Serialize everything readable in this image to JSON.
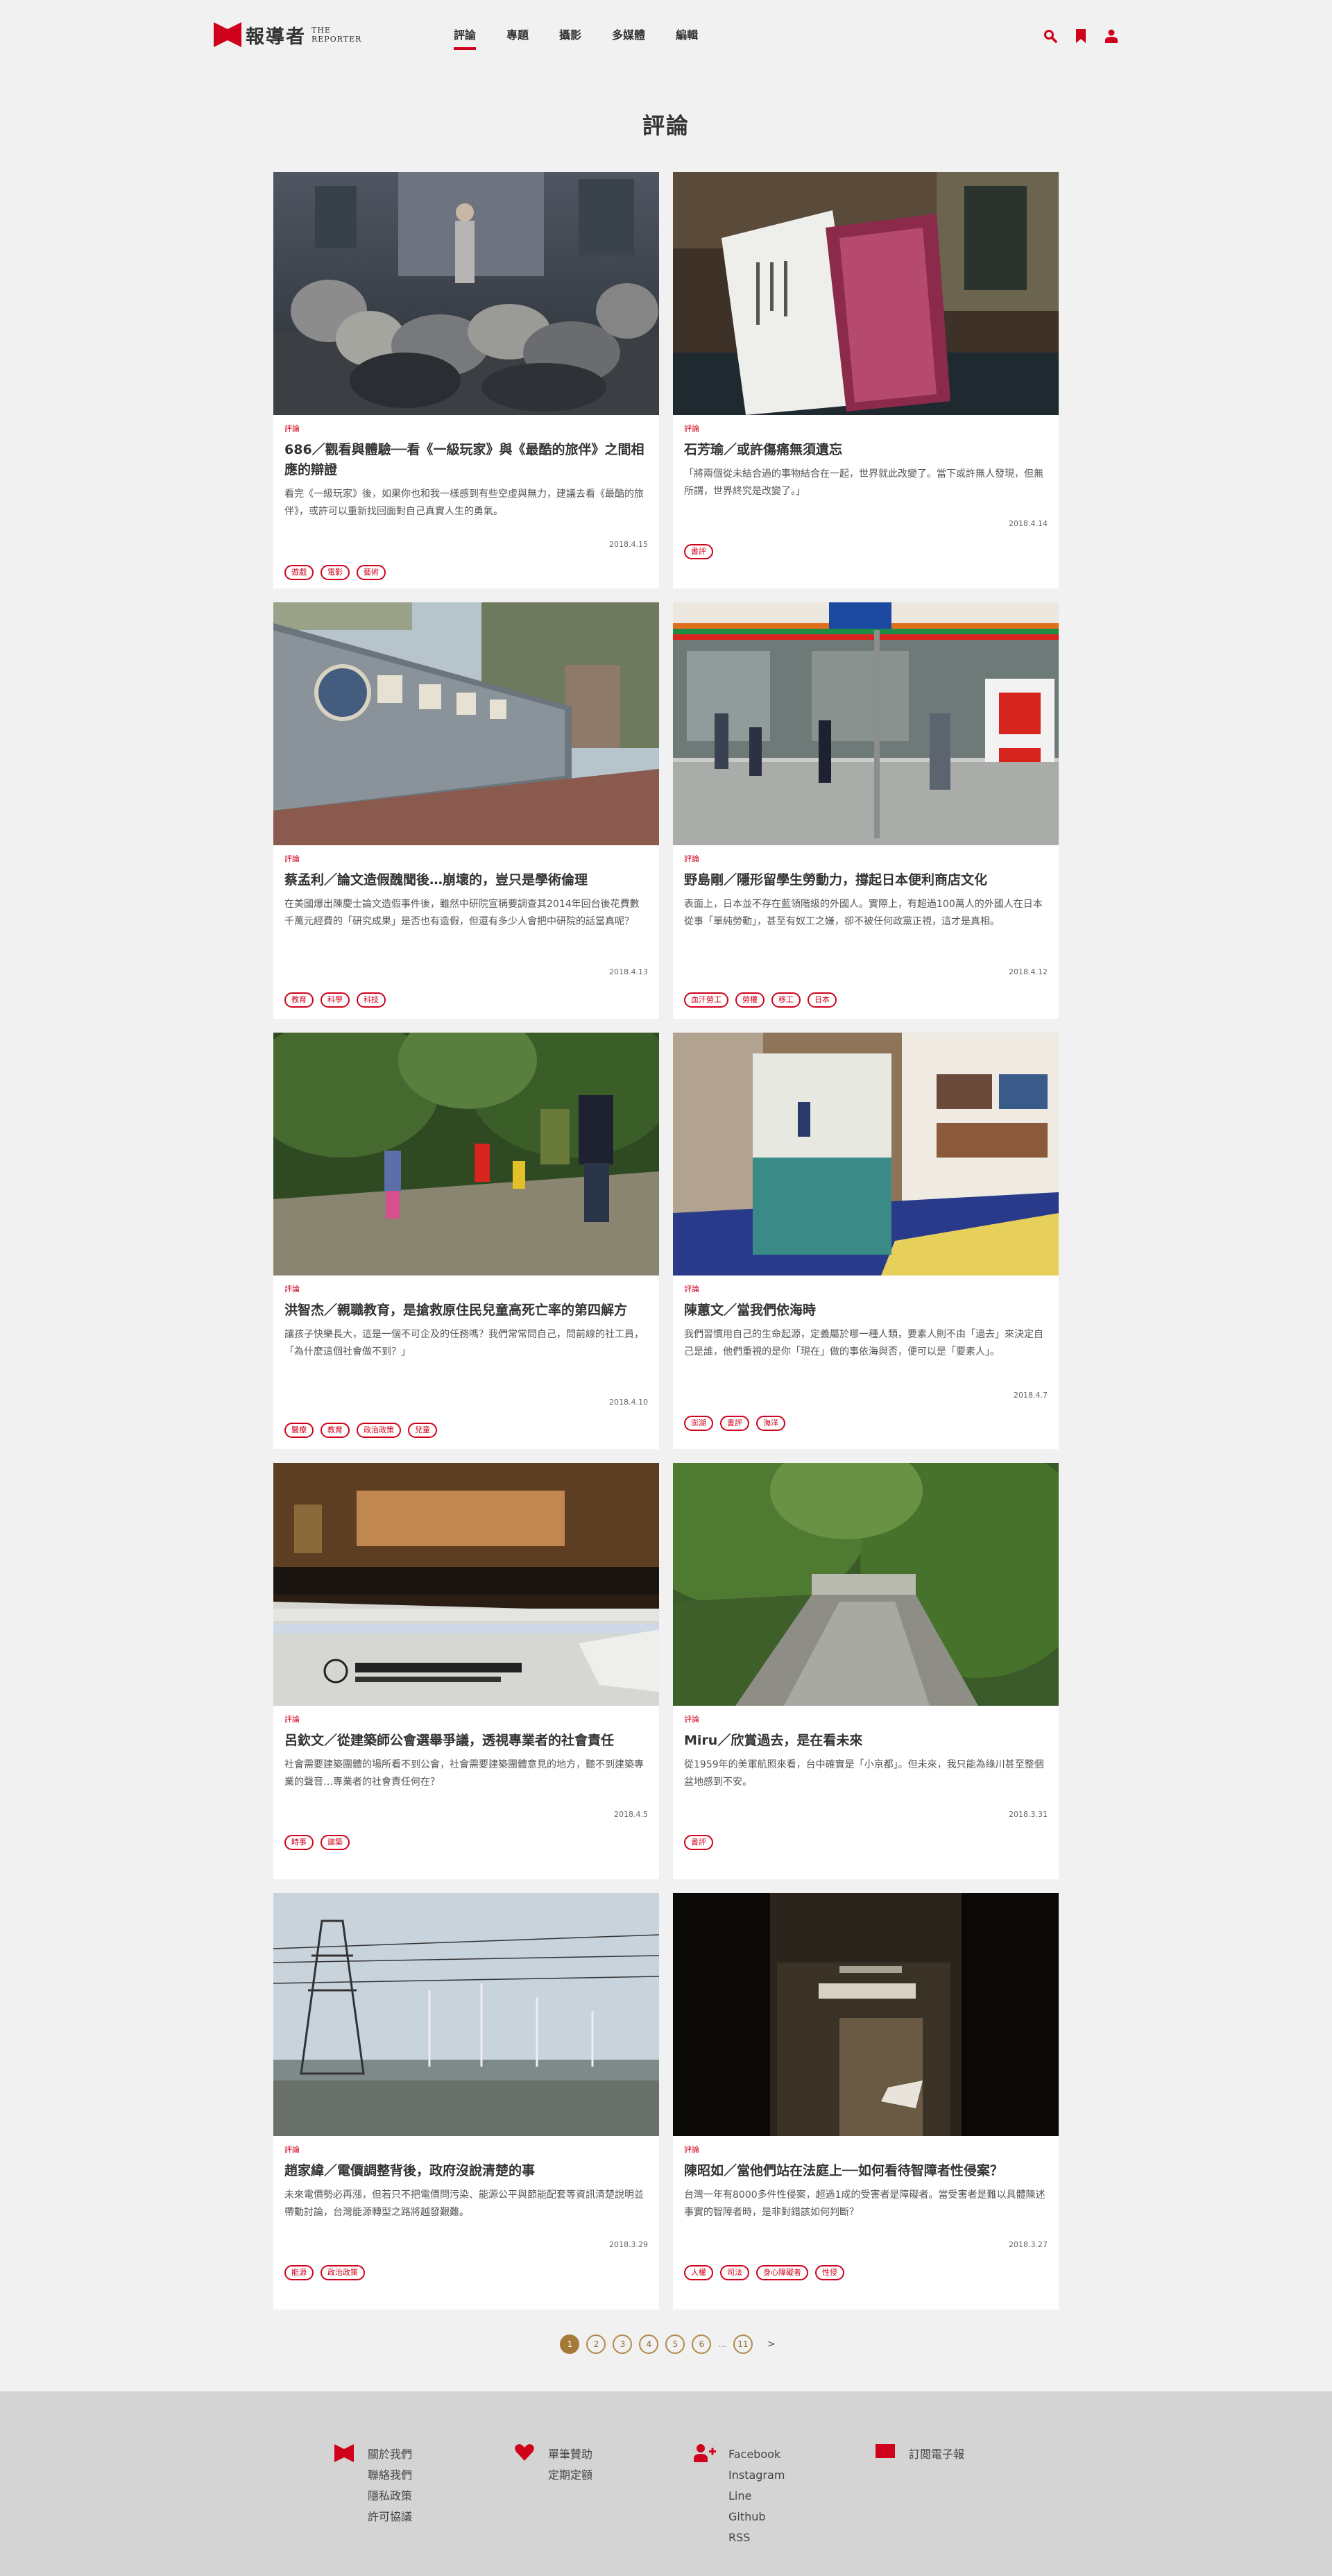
{
  "brand": {
    "name_zh": "報導者",
    "name_en_1": "THE",
    "name_en_2": "REPORTER"
  },
  "nav": [
    {
      "label": "評論",
      "active": true
    },
    {
      "label": "專題",
      "active": false
    },
    {
      "label": "攝影",
      "active": false
    },
    {
      "label": "多媒體",
      "active": false
    },
    {
      "label": "編輯",
      "active": false
    }
  ],
  "tools": [
    "search-icon",
    "bookmark-icon",
    "user-icon"
  ],
  "colors": {
    "accent": "#d0021b",
    "pagination": "#a47a36",
    "background": "#f1f1f1",
    "footer": "#d4d4d4"
  },
  "section_title": "評論",
  "articles": [
    {
      "category": "評論",
      "title": "686／觀看與體驗──看《一級玩家》與《最酷的旅伴》之間相應的辯證",
      "desc": "看完《一級玩家》後，如果你也和我一樣感到有些空虛與無力，建議去看《最酷的旅伴》，或許可以重新找回面對自己真實人生的勇氣。",
      "date": "2018.4.15",
      "tags": [
        "遊戲",
        "電影",
        "藝術"
      ]
    },
    {
      "category": "評論",
      "title": "石芳瑜／或許傷痛無須遺忘",
      "desc": "「將兩個從未結合過的事物結合在一起，世界就此改變了。當下或許無人發現，但無所謂，世界終究是改變了。」",
      "date": "2018.4.14",
      "tags": [
        "書評"
      ]
    },
    {
      "category": "評論",
      "title": "蔡孟利／論文造假醜聞後…崩壞的，豈只是學術倫理",
      "desc": "在美國爆出陳慶士論文造假事件後，雖然中研院宣稱要調查其2014年回台後花費數千萬元經費的「研究成果」是否也有造假，但還有多少人會把中研院的話當真呢？",
      "date": "2018.4.13",
      "tags": [
        "教育",
        "科學",
        "科技"
      ]
    },
    {
      "category": "評論",
      "title": "野島剛／隱形留學生勞動力，撐起日本便利商店文化",
      "desc": "表面上，日本並不存在藍領階級的外國人。實際上，有超過100萬人的外國人在日本從事「單純勞動」，甚至有奴工之嫌，卻不被任何政黨正視，這才是真相。",
      "date": "2018.4.12",
      "tags": [
        "血汗勞工",
        "勞權",
        "移工",
        "日本"
      ]
    },
    {
      "category": "評論",
      "title": "洪智杰／親職教育，是搶救原住民兒童高死亡率的第四解方",
      "desc": "讓孩子快樂長大，這是一個不可企及的任務嗎？我們常常問自己，問前線的社工員，「為什麼這個社會做不到？」",
      "date": "2018.4.10",
      "tags": [
        "醫療",
        "教育",
        "政治政策",
        "兒童"
      ]
    },
    {
      "category": "評論",
      "title": "陳蕙文／當我們依海時",
      "desc": "我們習慣用自己的生命起源，定義屬於哪一種人類，要素人則不由「過去」來決定自己是誰，他們重視的是你「現在」做的事依海與否，便可以是「要素人」。",
      "date": "2018.4.7",
      "tags": [
        "澎湖",
        "書評",
        "海洋"
      ]
    },
    {
      "category": "評論",
      "title": "呂欽文／從建築師公會選舉爭議，透視專業者的社會責任",
      "desc": "社會需要建築團體的場所看不到公會，社會需要建築團體意見的地方，聽不到建築專業的聲音…專業者的社會責任何在？",
      "date": "2018.4.5",
      "tags": [
        "時事",
        "建築"
      ]
    },
    {
      "category": "評論",
      "title": "Miru／欣賞過去，是在看未來",
      "desc": "從1959年的美軍航照來看，台中確實是「小京都」。但未來，我只能為綠川甚至整個盆地感到不安。",
      "date": "2018.3.31",
      "tags": [
        "書評"
      ]
    },
    {
      "category": "評論",
      "title": "趙家緯／電價調整背後，政府沒說清楚的事",
      "desc": "未來電價勢必再漲，但若只不把電價問污染、能源公平與節能配套等資訊清楚說明並帶動討論，台灣能源轉型之路將越發艱難。",
      "date": "2018.3.29",
      "tags": [
        "能源",
        "政治政策"
      ]
    },
    {
      "category": "評論",
      "title": "陳昭如／當他們站在法庭上──如何看待智障者性侵案？",
      "desc": "台灣一年有8000多件性侵案，超過1成的受害者是障礙者。當受害者是難以具體陳述事實的智障者時，是非對錯該如何判斷？",
      "date": "2018.3.27",
      "tags": [
        "人權",
        "司法",
        "身心障礙者",
        "性侵"
      ]
    }
  ],
  "pagination": {
    "pages": [
      "1",
      "2",
      "3",
      "4",
      "5",
      "6"
    ],
    "current": "1",
    "ellipsis": "...",
    "last": "11",
    "next": ">"
  },
  "footer": {
    "columns": [
      {
        "icon": "flag-icon",
        "links": [
          "關於我們",
          "聯絡我們",
          "隱私政策",
          "許可協議"
        ]
      },
      {
        "icon": "heart-icon",
        "links": [
          "單筆贊助",
          "定期定額"
        ]
      },
      {
        "icon": "add-user-icon",
        "links": [
          "Facebook",
          "Instagram",
          "Line",
          "Github",
          "RSS"
        ]
      },
      {
        "icon": "envelope-icon",
        "links": [
          "訂閱電子報"
        ]
      }
    ]
  }
}
